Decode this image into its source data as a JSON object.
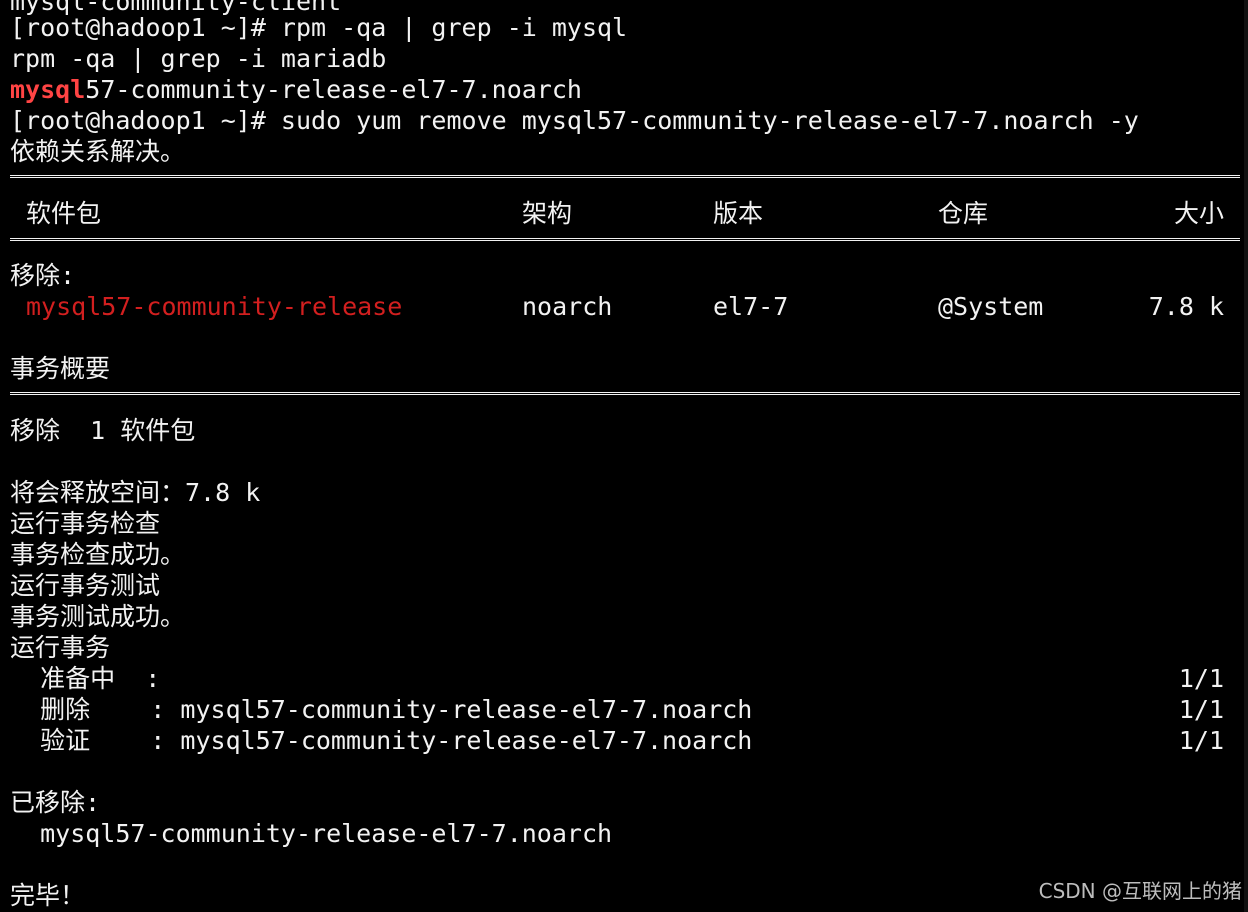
{
  "terminal": {
    "line0": "mysql-community-client",
    "line1": "[root@hadoop1 ~]# rpm -qa | grep -i mysql",
    "line2": "rpm -qa | grep -i mariadb",
    "line3_highlight": "mysql",
    "line3_rest": "57-community-release-el7-7.noarch",
    "line4": "[root@hadoop1 ~]# sudo yum remove mysql57-community-release-el7-7.noarch -y",
    "line5": "依赖关系解决。",
    "table": {
      "headers": {
        "package": "软件包",
        "arch": "架构",
        "version": "版本",
        "repo": "仓库",
        "size": "大小"
      },
      "section": "移除:",
      "row": {
        "package": "mysql57-community-release",
        "arch": "noarch",
        "version": "el7-7",
        "repo": "@System",
        "size": "7.8 k"
      }
    },
    "summary_title": "事务概要",
    "summary_remove": "移除  1 软件包",
    "free_space": "将会释放空间：7.8 k",
    "run_check": "运行事务检查",
    "check_ok": "事务检查成功。",
    "run_test": "运行事务测试",
    "test_ok": "事务测试成功。",
    "run_tx": "运行事务",
    "steps": [
      {
        "label": "  准备中  :",
        "detail": "",
        "progress": "1/1"
      },
      {
        "label": "  删除    :",
        "detail": " mysql57-community-release-el7-7.noarch",
        "progress": "1/1"
      },
      {
        "label": "  验证    :",
        "detail": " mysql57-community-release-el7-7.noarch",
        "progress": "1/1"
      }
    ],
    "removed_title": "已移除:",
    "removed_pkg": "  mysql57-community-release-el7-7.noarch",
    "done": "完毕！"
  },
  "watermark": "CSDN @互联网上的猪",
  "colors": {
    "background": "#000000",
    "foreground": "#f2f2f2",
    "package_red": "#d21f1f",
    "grep_match": "#ff4444"
  }
}
